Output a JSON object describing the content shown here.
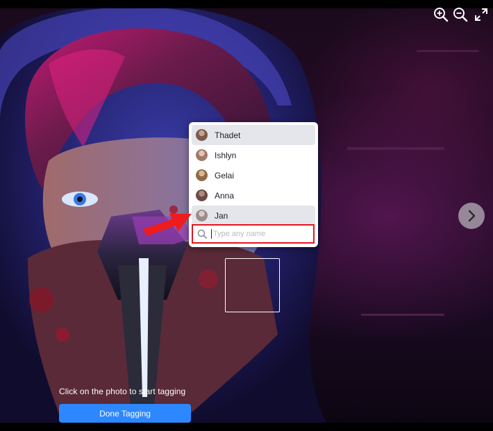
{
  "toolbar": {
    "zoom_in_icon": "zoom-in-icon",
    "zoom_out_icon": "zoom-out-icon",
    "fullscreen_icon": "expand-icon"
  },
  "navigation": {
    "next_icon": "chevron-right-icon"
  },
  "tag_menu": {
    "friends": [
      {
        "name": "Thadet",
        "avatar_color": "#7a5a4c",
        "highlighted": true
      },
      {
        "name": "Ishlyn",
        "avatar_color": "#a07a6a",
        "highlighted": false
      },
      {
        "name": "Gelai",
        "avatar_color": "#8d6b4a",
        "highlighted": false
      },
      {
        "name": "Anna",
        "avatar_color": "#6b4b45",
        "highlighted": false
      },
      {
        "name": "Jan",
        "avatar_color": "#9a8c8a",
        "highlighted": true
      }
    ],
    "search": {
      "placeholder": "Type any name",
      "value": ""
    }
  },
  "footer": {
    "hint": "Click on the photo to start tagging",
    "done_button": "Done Tagging"
  },
  "colors": {
    "accent": "#2d88ff",
    "highlight_border": "#e5131d",
    "item_highlight": "#e4e6eb"
  }
}
